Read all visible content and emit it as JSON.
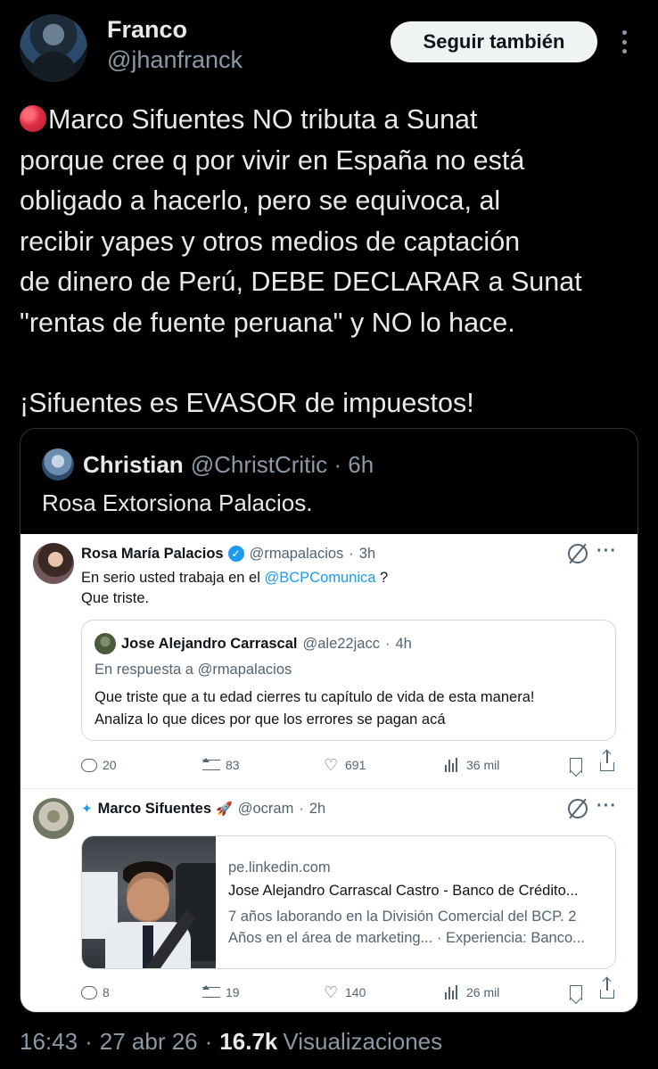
{
  "post": {
    "author_name": "Franco",
    "author_handle": "@jhanfranck",
    "follow_label": "Seguir también",
    "text_lines": [
      "Marco Sifuentes NO tributa a Sunat",
      "porque cree q por vivir en España no está",
      "obligado a hacerlo, pero se equivoca, al",
      "recibir yapes y otros medios de captación",
      "de dinero de Perú, DEBE DECLARAR a Sunat",
      "\"rentas de fuente peruana\" y NO lo hace."
    ],
    "text_last": "¡Sifuentes es EVASOR de impuestos!",
    "time": "16:43",
    "date": "27 abr 26",
    "views": "16.7k",
    "views_label": "Visualizaciones"
  },
  "quote": {
    "name": "Christian",
    "handle": "@ChristCritic",
    "time": "6h",
    "text": "Rosa Extorsiona Palacios."
  },
  "screenshot": {
    "tweet1": {
      "name": "Rosa María Palacios",
      "handle": "@rmapalacios",
      "time": "3h",
      "line1_prefix": "En serio usted trabaja en el",
      "line1_link": "@BCPComunica",
      "line1_suffix": "?",
      "line2": "Que triste.",
      "inner": {
        "name": "Jose Alejandro Carrascal",
        "handle": "@ale22jacc",
        "time": "4h",
        "reply_to": "En respuesta a @rmapalacios",
        "line1": "Que triste que a tu edad cierres tu capítulo de vida de esta manera!",
        "line2": "Analiza lo que dices por que los errores se pagan acá"
      },
      "stats": {
        "replies": "20",
        "reposts": "83",
        "likes": "691",
        "views": "36 mil"
      }
    },
    "tweet2": {
      "name": "Marco Sifuentes",
      "handle": "@ocram",
      "time": "2h",
      "link": {
        "domain": "pe.linkedin.com",
        "title": "Jose Alejandro Carrascal Castro - Banco de Crédito...",
        "desc1": "7 años laborando en la División Comercial del BCP. 2",
        "desc2": "Años en el área de marketing... · Experiencia: Banco..."
      },
      "stats": {
        "replies": "8",
        "reposts": "19",
        "likes": "140",
        "views": "26 mil"
      }
    }
  },
  "colors": {
    "background": "#000000",
    "text": "#e7e9ea",
    "muted": "#8b98a5",
    "accent": "#1d9bf0",
    "red_dot": "#dd2e44"
  },
  "icons": [
    "red-circle-icon",
    "more-icon",
    "verified-icon",
    "grok-icon",
    "reply-icon",
    "repost-icon",
    "heart-icon",
    "views-icon",
    "bookmark-icon",
    "share-icon",
    "twitter-bird-icon",
    "rocket-icon"
  ]
}
